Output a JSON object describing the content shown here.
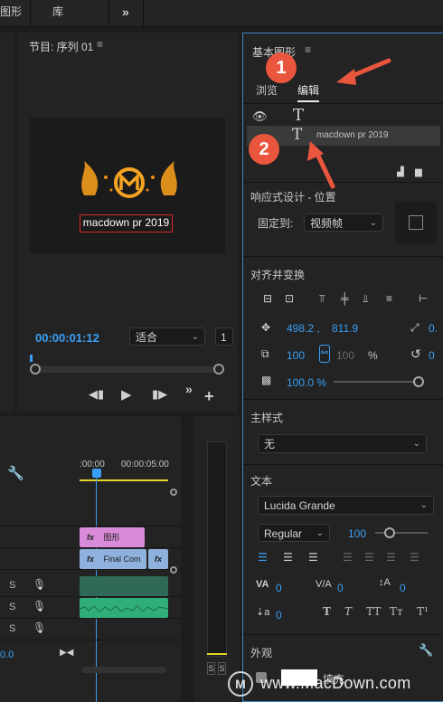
{
  "top_tabs": [
    "图形",
    "库"
  ],
  "top_more": "»",
  "program_monitor": {
    "title": "节目: 序列 01",
    "menu_glyph": "≡",
    "overlay_text": "macdown pr 2019",
    "timecode": "00:00:01:12",
    "fit_label": "适合",
    "page_num": "1",
    "more": "»",
    "add": "+"
  },
  "timeline": {
    "ruler_labels": [
      ":00:00",
      "00:00:05:00"
    ],
    "tracks": [
      {
        "s": "",
        "clip": "图形"
      },
      {
        "s": "",
        "clip": "Final Com"
      },
      {
        "s": "S"
      },
      {
        "s": "S"
      },
      {
        "s": "S"
      }
    ],
    "clip_graphic_label": "图形",
    "clip_video_label": "Final Com",
    "fx_label": "fx",
    "bottom_value": "0.0"
  },
  "meter": {
    "solo_labels": [
      "S",
      "S"
    ]
  },
  "egp": {
    "title": "基本图形",
    "menu_glyph": "≡",
    "tabs": [
      "浏览",
      "编辑"
    ],
    "active_tab": "编辑",
    "layer_text": "macdown pr 2019",
    "responsive": {
      "heading": "响应式设计 - 位置",
      "pin_label": "固定到:",
      "pin_value": "视频帧"
    },
    "align": {
      "heading": "对齐并变换",
      "pos_x": "498.2 ,",
      "pos_y": "811.9",
      "rot": "0.",
      "scale": "100",
      "scale2": "100",
      "pct": "%",
      "rot2": "0",
      "opacity": "100.0 %"
    },
    "master_style": {
      "heading": "主样式",
      "value": "无"
    },
    "text": {
      "heading": "文本",
      "font": "Lucida Grande",
      "style": "Regular",
      "size": "100",
      "tracking": "0",
      "kerning": "0",
      "leading": "0",
      "baseline": "0",
      "typo_buttons": [
        "T",
        "T",
        "TT",
        "Tт",
        "T¹"
      ]
    },
    "appearance": {
      "heading": "外观",
      "fill_label": "填充"
    }
  },
  "markers": [
    "1",
    "2"
  ],
  "watermark": "www.MacDown.com",
  "colors": {
    "accent": "#3a9ff7",
    "marker": "#e9563d",
    "selection": "#3d84c6",
    "graphic_clip": "#d98ad8",
    "video_clip": "#8fb1de",
    "audio_clip": "#2fae7a"
  }
}
